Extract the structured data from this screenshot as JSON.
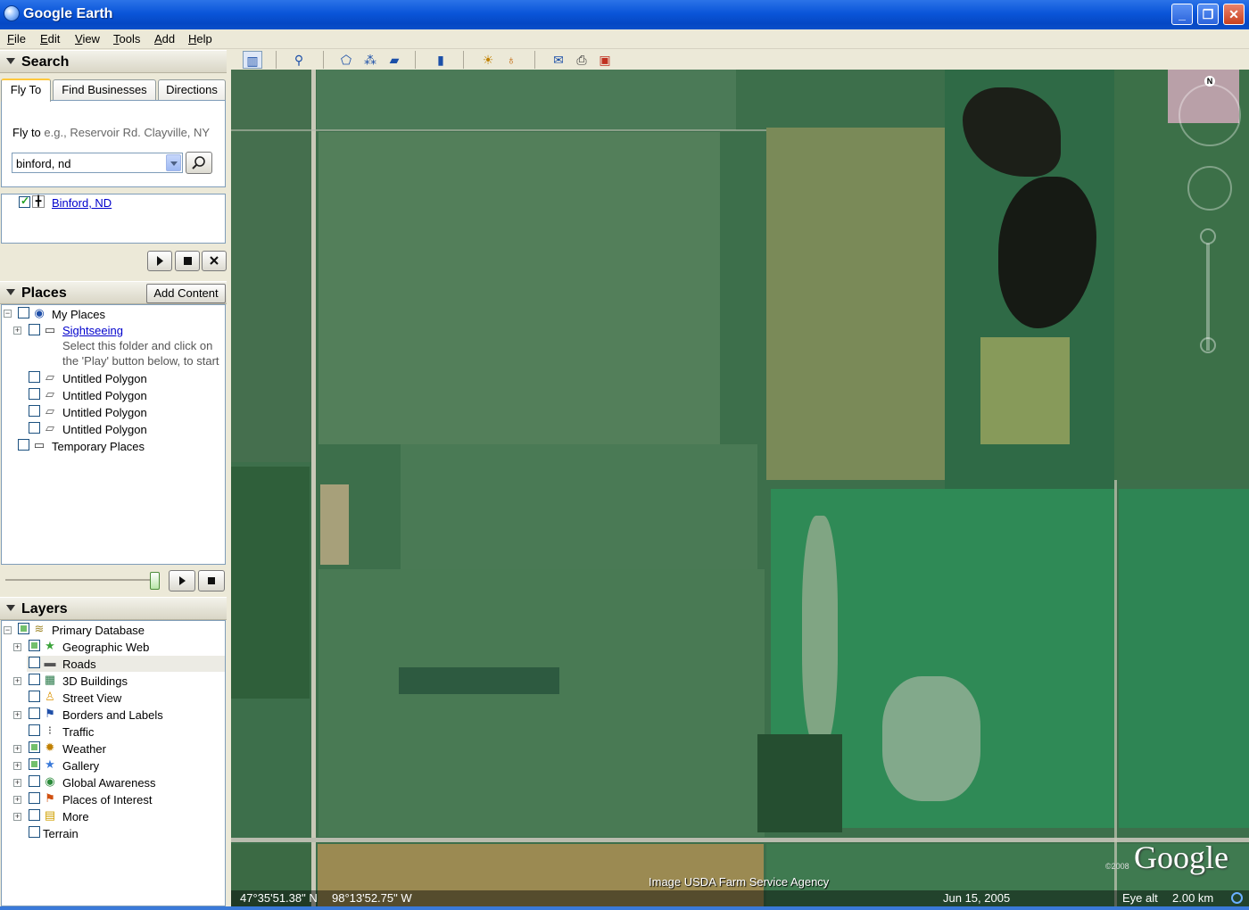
{
  "window": {
    "title": "Google Earth",
    "controls": {
      "minimize": "_",
      "maximize": "❐",
      "close": "✕"
    }
  },
  "menu": [
    "File",
    "Edit",
    "View",
    "Tools",
    "Add",
    "Help"
  ],
  "search": {
    "header": "Search",
    "tabs": [
      "Fly To",
      "Find Businesses",
      "Directions"
    ],
    "active_tab": "Fly To",
    "fly_to_label": "Fly to",
    "fly_to_hint": "e.g., Reservoir Rd. Clayville, NY",
    "query_value": "binford, nd",
    "results": [
      {
        "label": "Binford, ND",
        "checked": true
      }
    ]
  },
  "places": {
    "header": "Places",
    "add_content_label": "Add Content",
    "items": [
      {
        "label": "My Places",
        "icon": "globe-icon",
        "level": 0
      },
      {
        "label": "Sightseeing",
        "icon": "folder-icon",
        "level": 1,
        "link": true
      },
      {
        "label": "Select this folder and click on",
        "level": 2,
        "note": true
      },
      {
        "label": "the 'Play' button below, to start",
        "level": 2,
        "note": true
      },
      {
        "label": "Untitled Polygon",
        "icon": "polygon-icon",
        "level": 1
      },
      {
        "label": "Untitled Polygon",
        "icon": "polygon-icon",
        "level": 1
      },
      {
        "label": "Untitled Polygon",
        "icon": "polygon-icon",
        "level": 1
      },
      {
        "label": "Untitled Polygon",
        "icon": "polygon-icon",
        "level": 1
      },
      {
        "label": "Temporary Places",
        "icon": "folder-icon",
        "level": 0
      }
    ]
  },
  "layers": {
    "header": "Layers",
    "items": [
      {
        "label": "Primary Database",
        "icon": "database-icon"
      },
      {
        "label": "Geographic Web",
        "icon": "star-icon"
      },
      {
        "label": "Roads",
        "icon": "road-icon"
      },
      {
        "label": "3D Buildings",
        "icon": "building-icon"
      },
      {
        "label": "Street View",
        "icon": "pegman-icon"
      },
      {
        "label": "Borders and Labels",
        "icon": "flag-icon"
      },
      {
        "label": "Traffic",
        "icon": "traffic-light-icon"
      },
      {
        "label": "Weather",
        "icon": "sun-icon"
      },
      {
        "label": "Gallery",
        "icon": "star-icon"
      },
      {
        "label": "Global Awareness",
        "icon": "globe-icon"
      },
      {
        "label": "Places of Interest",
        "icon": "flag-icon"
      },
      {
        "label": "More",
        "icon": "note-icon"
      },
      {
        "label": "Terrain",
        "icon": ""
      }
    ]
  },
  "map": {
    "compass_label": "N",
    "imagery_credit": "Image USDA Farm Service Agency",
    "logo": "Google",
    "copyright": "©2008",
    "latitude": "47°35'51.38\" N",
    "longitude": "98°13'52.75\" W",
    "imagery_date": "Jun 15, 2005",
    "eye_alt_label": "Eye alt",
    "eye_alt_value": "2.00 km"
  }
}
